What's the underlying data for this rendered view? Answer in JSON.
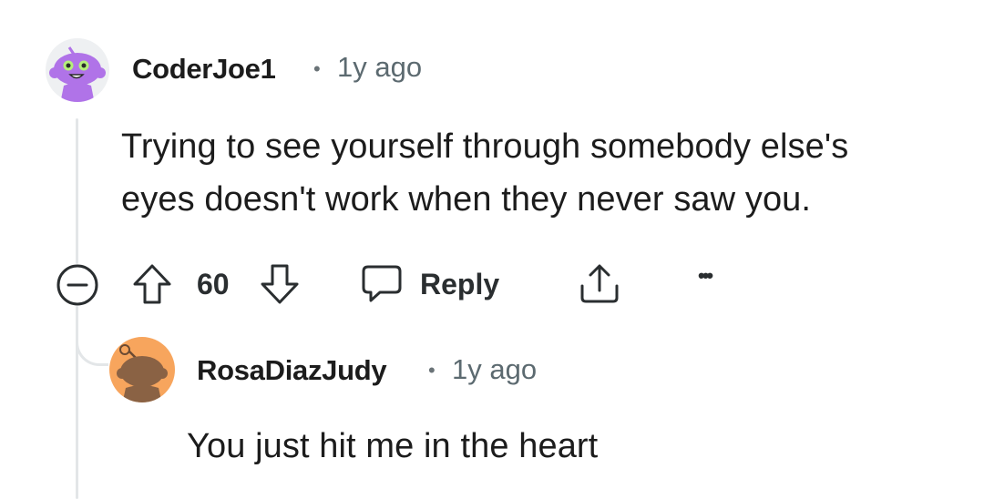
{
  "comment": {
    "username": "CoderJoe1",
    "separator": "•",
    "age": "1y ago",
    "body_line1": "Trying to see yourself through somebody else's",
    "body_line2": "eyes doesn't work when they never saw you.",
    "actions": {
      "vote_count": "60",
      "reply_label": "Reply",
      "more_label": "•••"
    }
  },
  "reply": {
    "username": "RosaDiazJudy",
    "separator": "•",
    "age": "1y ago",
    "body": "You just hit me in the heart"
  },
  "colors": {
    "avatar1_bg": "#eef0f2",
    "avatar1_snoo": "#b073e8",
    "avatar2_bg": "#f7a55d",
    "avatar2_snoo": "#8a6244",
    "thread_line": "#e3e6e8",
    "text": "#1c1c1c",
    "meta": "#5c6a70"
  }
}
